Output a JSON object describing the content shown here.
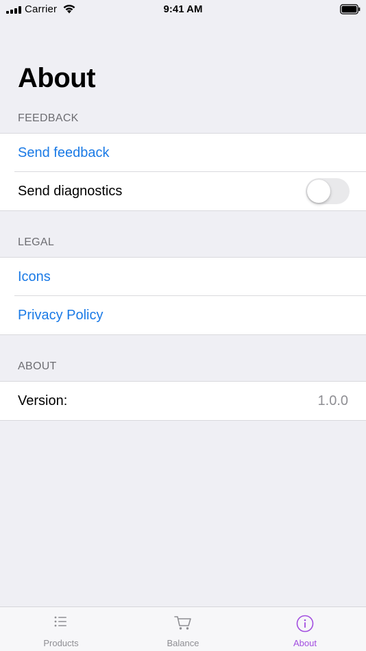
{
  "status_bar": {
    "carrier": "Carrier",
    "time": "9:41 AM"
  },
  "page": {
    "title": "About"
  },
  "sections": {
    "feedback": {
      "header": "FEEDBACK",
      "send_feedback": "Send feedback",
      "send_diagnostics": "Send diagnostics",
      "diagnostics_enabled": false
    },
    "legal": {
      "header": "LEGAL",
      "icons": "Icons",
      "privacy_policy": "Privacy Policy"
    },
    "about": {
      "header": "ABOUT",
      "version_label": "Version:",
      "version_value": "1.0.0"
    }
  },
  "tab_bar": {
    "tabs": [
      {
        "label": "Products",
        "icon": "list-icon",
        "active": false
      },
      {
        "label": "Balance",
        "icon": "cart-icon",
        "active": false
      },
      {
        "label": "About",
        "icon": "info-icon",
        "active": true
      }
    ]
  },
  "colors": {
    "link": "#1a7ae6",
    "active_tab": "#a24de0",
    "inactive_tab": "#8e8e93",
    "background": "#efeff4"
  }
}
